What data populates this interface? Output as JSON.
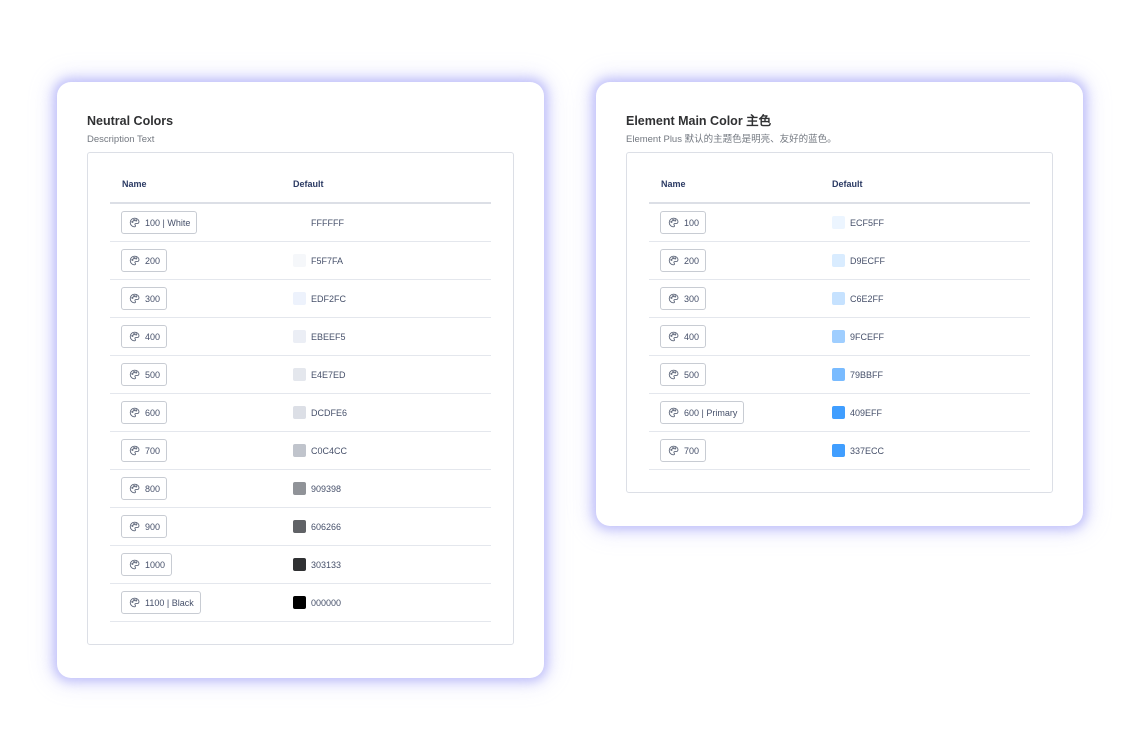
{
  "neutral": {
    "title": "Neutral Colors",
    "description": "Description Text",
    "headers": {
      "name": "Name",
      "default": "Default"
    },
    "rows": [
      {
        "label": "100 | White",
        "hex": "FFFFFF",
        "color": "#FFFFFF"
      },
      {
        "label": "200",
        "hex": "F5F7FA",
        "color": "#F5F7FA"
      },
      {
        "label": "300",
        "hex": "EDF2FC",
        "color": "#EDF2FC"
      },
      {
        "label": "400",
        "hex": "EBEEF5",
        "color": "#EBEEF5"
      },
      {
        "label": "500",
        "hex": "E4E7ED",
        "color": "#E4E7ED"
      },
      {
        "label": "600",
        "hex": "DCDFE6",
        "color": "#DCDFE6"
      },
      {
        "label": "700",
        "hex": "C0C4CC",
        "color": "#C0C4CC"
      },
      {
        "label": "800",
        "hex": "909398",
        "color": "#909398"
      },
      {
        "label": "900",
        "hex": "606266",
        "color": "#606266"
      },
      {
        "label": "1000",
        "hex": "303133",
        "color": "#303133"
      },
      {
        "label": "1100 | Black",
        "hex": "000000",
        "color": "#000000"
      }
    ]
  },
  "main_color": {
    "title": "Element Main Color 主色",
    "description": "Element Plus 默认的主题色是明亮、友好的蓝色。",
    "headers": {
      "name": "Name",
      "default": "Default"
    },
    "rows": [
      {
        "label": "100",
        "hex": "ECF5FF",
        "color": "#ECF5FF"
      },
      {
        "label": "200",
        "hex": "D9ECFF",
        "color": "#D9ECFF"
      },
      {
        "label": "300",
        "hex": "C6E2FF",
        "color": "#C6E2FF"
      },
      {
        "label": "400",
        "hex": "9FCEFF",
        "color": "#9FCEFF"
      },
      {
        "label": "500",
        "hex": "79BBFF",
        "color": "#79BBFF"
      },
      {
        "label": "600 | Primary",
        "hex": "409EFF",
        "color": "#409EFF"
      },
      {
        "label": "700",
        "hex": "337ECC",
        "color": "#409EFF"
      }
    ]
  },
  "chip_icon": "palette-icon"
}
